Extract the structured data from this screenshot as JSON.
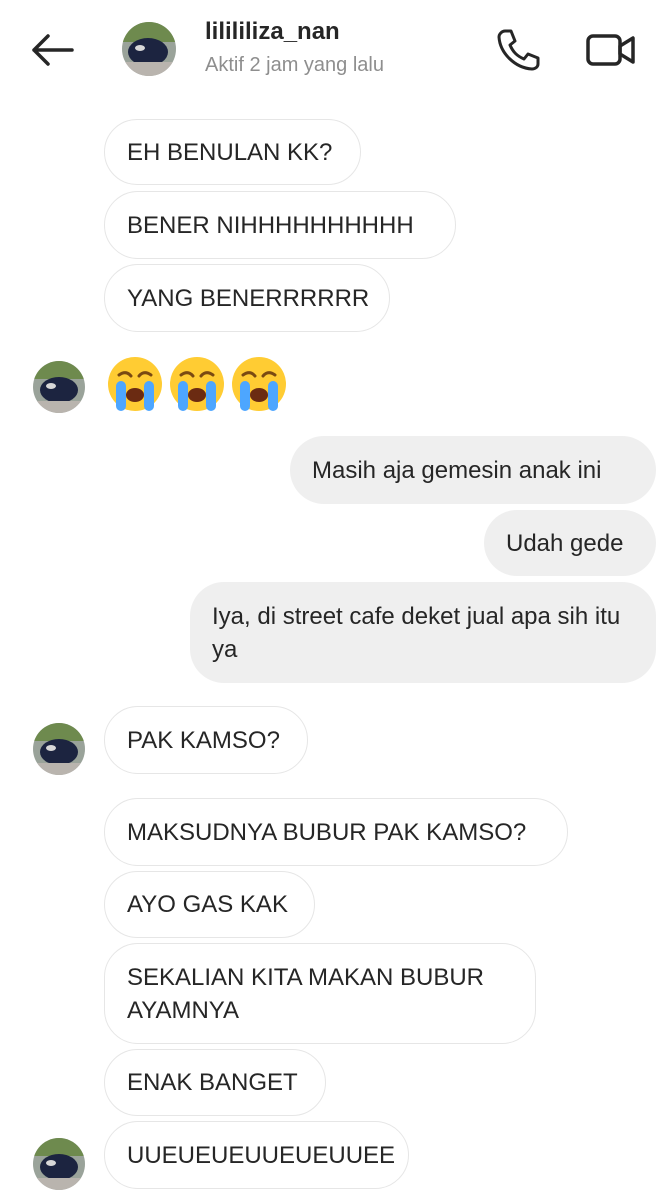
{
  "header": {
    "username": "lilililiza_nan",
    "status": "Aktif 2 jam yang lalu"
  },
  "messages": {
    "m1": "EH BENULAN KK?",
    "m2": "BENER NIHHHHHHHHHH",
    "m3": "YANG BENERRRRRR",
    "emoji": [
      "loudly-crying-face",
      "loudly-crying-face",
      "loudly-crying-face"
    ],
    "o1": "Masih aja gemesin anak ini",
    "o2": "Udah gede",
    "o3": "Iya, di street cafe deket jual apa sih itu ya",
    "m4": "PAK KAMSO?",
    "m5": "MAKSUDNYA BUBUR PAK KAMSO?",
    "m6": "AYO GAS KAK",
    "m7": "SEKALIAN KITA MAKAN BUBUR AYAMNYA",
    "m8": "ENAK BANGET",
    "m9": "UUEUEUEUUEUEUUEE"
  },
  "colors": {
    "incoming_border": "#e6e6e6",
    "outgoing_bg": "#efefef",
    "muted_text": "#8e8e8e"
  }
}
